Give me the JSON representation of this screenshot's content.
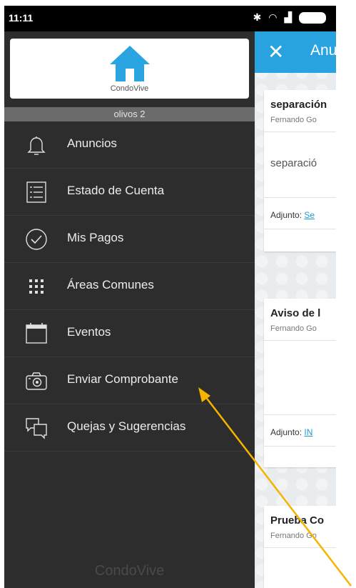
{
  "status_bar": {
    "time": "11:11",
    "icons": [
      "bluetooth-icon",
      "wifi-icon",
      "signal-icon",
      "battery-icon"
    ]
  },
  "drawer": {
    "logo_text": "CondoVive",
    "condo_name": "olivos 2",
    "items": [
      {
        "label": "Anuncios",
        "icon": "bell-icon"
      },
      {
        "label": "Estado de Cuenta",
        "icon": "list-icon"
      },
      {
        "label": "Mis Pagos",
        "icon": "check-circle-icon"
      },
      {
        "label": "Áreas Comunes",
        "icon": "grid-icon"
      },
      {
        "label": "Eventos",
        "icon": "calendar-icon"
      },
      {
        "label": "Enviar Comprobante",
        "icon": "camera-icon"
      },
      {
        "label": "Quejas y Sugerencias",
        "icon": "chat-icon"
      }
    ],
    "footer": "CondoVive"
  },
  "content": {
    "appbar_title": "Anuncios",
    "cards": [
      {
        "title": "separación",
        "author": "Fernando Go",
        "body": "separació",
        "attachment_label": "Adjunto:",
        "attachment_link": "Se"
      },
      {
        "title": "Aviso de l",
        "author": "Fernando Go",
        "body": "",
        "attachment_label": "Adjunto:",
        "attachment_link": "IN"
      },
      {
        "title": "Prueba Co",
        "author": "Fernando Go",
        "body": "",
        "attachment_label": "",
        "attachment_link": ""
      }
    ]
  },
  "colors": {
    "drawer_bg": "#2d2d2d",
    "appbar": "#29a3e0",
    "logo_blue": "#2aa5e1",
    "annotation_arrow": "#f5b400"
  }
}
